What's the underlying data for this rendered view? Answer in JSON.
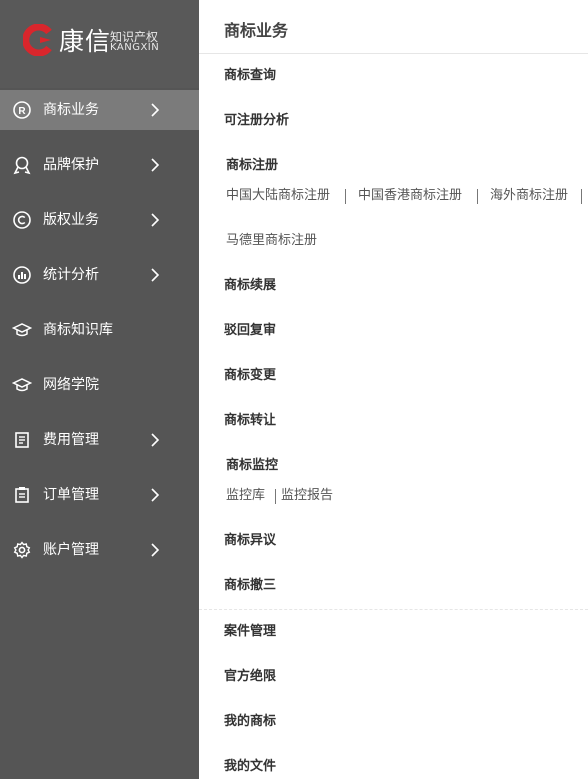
{
  "brand": {
    "name": "康信",
    "cn_tag": "知识产权",
    "en_tag": "KANGXIN"
  },
  "sidebar": {
    "items": [
      {
        "label": "商标业务",
        "icon": "registered-icon",
        "chevron": true,
        "active": true
      },
      {
        "label": "品牌保护",
        "icon": "award-icon",
        "chevron": true,
        "active": false
      },
      {
        "label": "版权业务",
        "icon": "copyright-icon",
        "chevron": true,
        "active": false
      },
      {
        "label": "统计分析",
        "icon": "chart-icon",
        "chevron": true,
        "active": false
      },
      {
        "label": "商标知识库",
        "icon": "graduation-cap-icon",
        "chevron": false,
        "active": false
      },
      {
        "label": "网络学院",
        "icon": "graduation-cap-icon",
        "chevron": false,
        "active": false
      },
      {
        "label": "费用管理",
        "icon": "document-icon",
        "chevron": true,
        "active": false
      },
      {
        "label": "订单管理",
        "icon": "clipboard-icon",
        "chevron": true,
        "active": false
      },
      {
        "label": "账户管理",
        "icon": "gear-icon",
        "chevron": true,
        "active": false
      }
    ]
  },
  "panel": {
    "title": "商标业务",
    "menu": {
      "search": "商标查询",
      "analysis": "可注册分析",
      "register": "商标注册",
      "register_subs": [
        "中国大陆商标注册",
        "中国香港商标注册",
        "海外商标注册",
        "马德里商标注册"
      ],
      "renewal": "商标续展",
      "review": "驳回复审",
      "change": "商标变更",
      "transfer": "商标转让",
      "monitor": "商标监控",
      "monitor_subs": [
        "监控库",
        "监控报告"
      ],
      "objection": "商标异议",
      "cancel3": "商标撤三",
      "cases": "案件管理",
      "official_deadline": "官方绝限",
      "my_marks": "我的商标",
      "my_files": "我的文件"
    }
  },
  "colors": {
    "sidebar_bg": "#555555",
    "active_bg": "#7b7b7b",
    "logo_red": "#d9262c"
  }
}
